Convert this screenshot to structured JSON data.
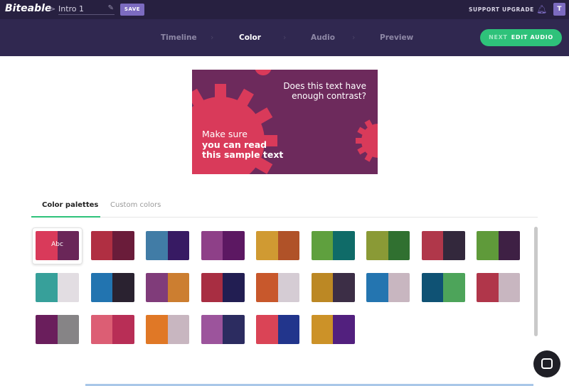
{
  "header": {
    "logo": "Biteable",
    "breadcrumb_sep": ">",
    "project_title": "Intro 1",
    "edit_icon": "pencil-icon",
    "save_label": "SAVE",
    "support_label": "SUPPORT",
    "upgrade_label": "UPGRADE",
    "notification_icon": "bell-icon",
    "avatar_initial": "T"
  },
  "steps": [
    {
      "label": "Timeline"
    },
    {
      "label": "Color",
      "active": true
    },
    {
      "label": "Audio"
    },
    {
      "label": "Preview"
    }
  ],
  "next_button": {
    "prefix": "NEXT",
    "label": "EDIT AUDIO"
  },
  "preview": {
    "question": "Does this text have enough contrast?",
    "line1": "Make sure",
    "line2": "you can read",
    "line3": "this sample text"
  },
  "tabs": [
    {
      "label": "Color palettes",
      "active": true
    },
    {
      "label": "Custom colors"
    }
  ],
  "selected_palette_label": "Abc",
  "palettes": [
    [
      "#d93a5a",
      "#6a2658"
    ],
    [
      "#b02f42",
      "#6a1c3a"
    ],
    [
      "#417ca6",
      "#371a63"
    ],
    [
      "#8e4088",
      "#5c1862"
    ],
    [
      "#d09a32",
      "#b05228"
    ],
    [
      "#5fa03e",
      "#0f6b68"
    ],
    [
      "#8a9a36",
      "#307030"
    ],
    [
      "#b0374a",
      "#33283c"
    ],
    [
      "#5f9a3a",
      "#3e2044"
    ],
    [
      "#37a09a",
      "#e2dde2"
    ],
    [
      "#2274b0",
      "#2a2230"
    ],
    [
      "#803c7a",
      "#cc7e30"
    ],
    [
      "#a82e42",
      "#221e52"
    ],
    [
      "#c8582c",
      "#d5ccd4"
    ],
    [
      "#bc8824",
      "#3c2e46"
    ],
    [
      "#2475b0",
      "#c8b6c0"
    ],
    [
      "#0f5274",
      "#4da45a"
    ],
    [
      "#b0364a",
      "#c8b6c0"
    ],
    [
      "#6a1e5c",
      "#868486"
    ],
    [
      "#dc5e74",
      "#b82e56"
    ],
    [
      "#e07826",
      "#c8b6c0"
    ],
    [
      "#9c549c",
      "#2c2c60"
    ],
    [
      "#da4456",
      "#22358c"
    ],
    [
      "#cc9228",
      "#52207e"
    ]
  ],
  "colors": {
    "accent": "#2ec27a",
    "header_bg": "#272040",
    "nav_bg": "#302850",
    "save_bg": "#7c6bc0"
  }
}
